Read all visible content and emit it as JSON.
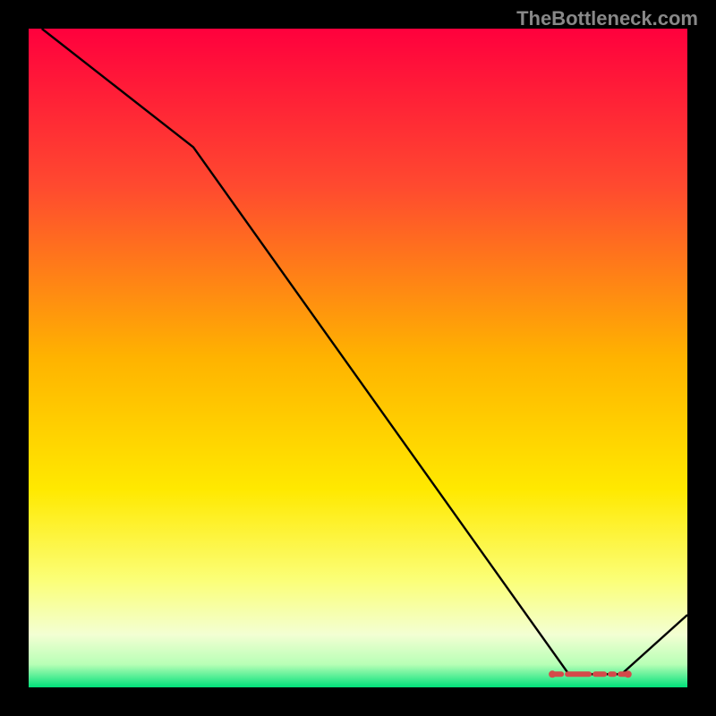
{
  "watermark": "TheBottleneck.com",
  "chart_data": {
    "type": "line",
    "title": "",
    "xlabel": "",
    "ylabel": "",
    "xlim": [
      0,
      100
    ],
    "ylim": [
      0,
      100
    ],
    "x": [
      2,
      25,
      82,
      90,
      100
    ],
    "values": [
      100,
      82,
      2,
      2,
      11
    ],
    "optimal_band": {
      "x_start": 79.5,
      "x_end": 91
    },
    "gradient_stops": [
      {
        "offset": 0,
        "color": "#ff003d"
      },
      {
        "offset": 0.24,
        "color": "#ff4a2f"
      },
      {
        "offset": 0.5,
        "color": "#ffb300"
      },
      {
        "offset": 0.7,
        "color": "#ffe900"
      },
      {
        "offset": 0.84,
        "color": "#fbff7a"
      },
      {
        "offset": 0.92,
        "color": "#f3ffd3"
      },
      {
        "offset": 0.965,
        "color": "#b8ffb6"
      },
      {
        "offset": 1.0,
        "color": "#00e07a"
      }
    ]
  }
}
